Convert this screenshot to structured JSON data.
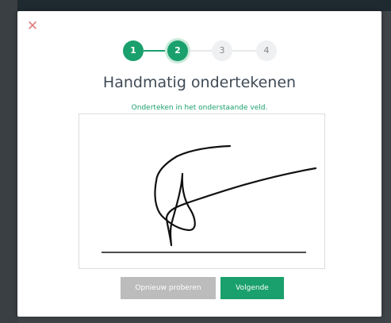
{
  "modal": {
    "close_icon": "close-icon",
    "title": "Handmatig ondertekenen",
    "instruction": "Onderteken in het onderstaande veld."
  },
  "stepper": {
    "current_step": 2,
    "steps": [
      {
        "label": "1",
        "state": "done"
      },
      {
        "label": "2",
        "state": "current"
      },
      {
        "label": "3",
        "state": "todo"
      },
      {
        "label": "4",
        "state": "todo"
      }
    ]
  },
  "buttons": {
    "retry_label": "Opnieuw proberen",
    "next_label": "Volgende"
  },
  "colors": {
    "accent": "#1aa06d",
    "close": "#e07b7b",
    "retry_bg": "#bcbcbc",
    "title": "#3f4a55"
  }
}
